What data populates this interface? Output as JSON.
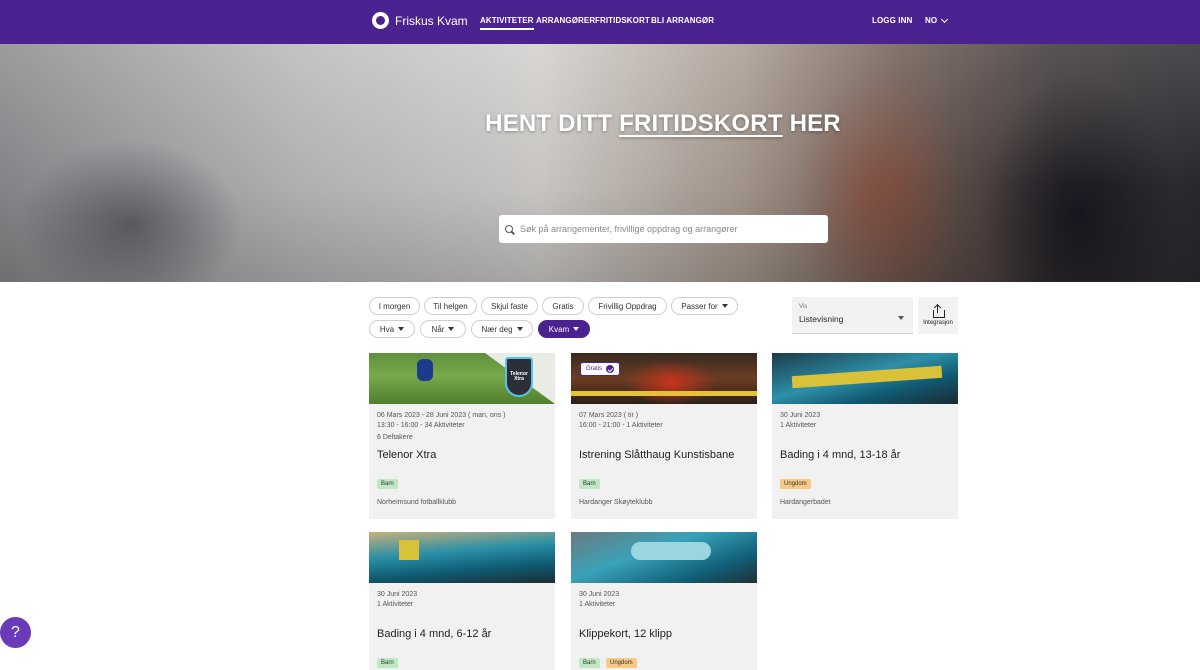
{
  "nav": {
    "brand": "Friskus Kvam",
    "links": [
      {
        "label": "AKTIVITETER",
        "active": true
      },
      {
        "label": "ARRANGØRER",
        "active": false
      },
      {
        "label": "FRITIDSKORT",
        "active": false
      },
      {
        "label": "BLI ARRANGØR",
        "active": false
      }
    ],
    "login": "LOGG INN",
    "language": "NO"
  },
  "hero": {
    "title_pre": "HENT DITT",
    "title_link": "FRITIDSKORT",
    "title_post": "HER",
    "search_placeholder": "Søk på arrangementer, frivillige oppdrag og arrangører"
  },
  "filters": {
    "row1": [
      "I morgen",
      "Til helgen",
      "Skjul faste",
      "Gratis",
      "Frivillig Oppdrag",
      "Passer for"
    ],
    "row2": [
      "Hva",
      "Når",
      "Nær deg",
      "Kvam"
    ]
  },
  "view": {
    "label": "Vis",
    "value": "Listevisning",
    "integration": "Integrasjon"
  },
  "cards": [
    {
      "dates": "06 Mars 2023 - 28 Juni 2023 ( man, ons )",
      "time": "13:30 - 16:00  -  34  Aktiviteter",
      "participants": "6 Deltakere",
      "title": "Telenor Xtra",
      "tags": [
        "Barn"
      ],
      "organizer": "Norheimsund fotballklubb",
      "image_label": "Telenor Xtra"
    },
    {
      "dates": "07 Mars 2023 ( tir )",
      "time": "16:00 - 21:00  -  1  Aktiviteter",
      "title": "Istrening Slåtthaug Kunstisbane",
      "tags": [
        "Barn"
      ],
      "organizer": "Hardanger Skøyteklubb",
      "badge": "Gratis"
    },
    {
      "dates": "30 Juni 2023",
      "time": "1  Aktiviteter",
      "title": "Bading i 4 mnd, 13-18 år",
      "tags": [
        "Ungdom"
      ],
      "organizer": "Hardangerbadet"
    },
    {
      "dates": "30 Juni 2023",
      "time": "1  Aktiviteter",
      "title": "Bading i 4 mnd, 6-12 år",
      "tags": [
        "Barn"
      ]
    },
    {
      "dates": "30 Juni 2023",
      "time": "1  Aktiviteter",
      "title": "Klippekort, 12 klipp",
      "tags": [
        "Barn",
        "Ungdom"
      ]
    }
  ],
  "help": "?",
  "colors": {
    "brand": "#4b2391",
    "tag_barn": "#bfe8c4",
    "tag_ungdom": "#f9c985"
  }
}
